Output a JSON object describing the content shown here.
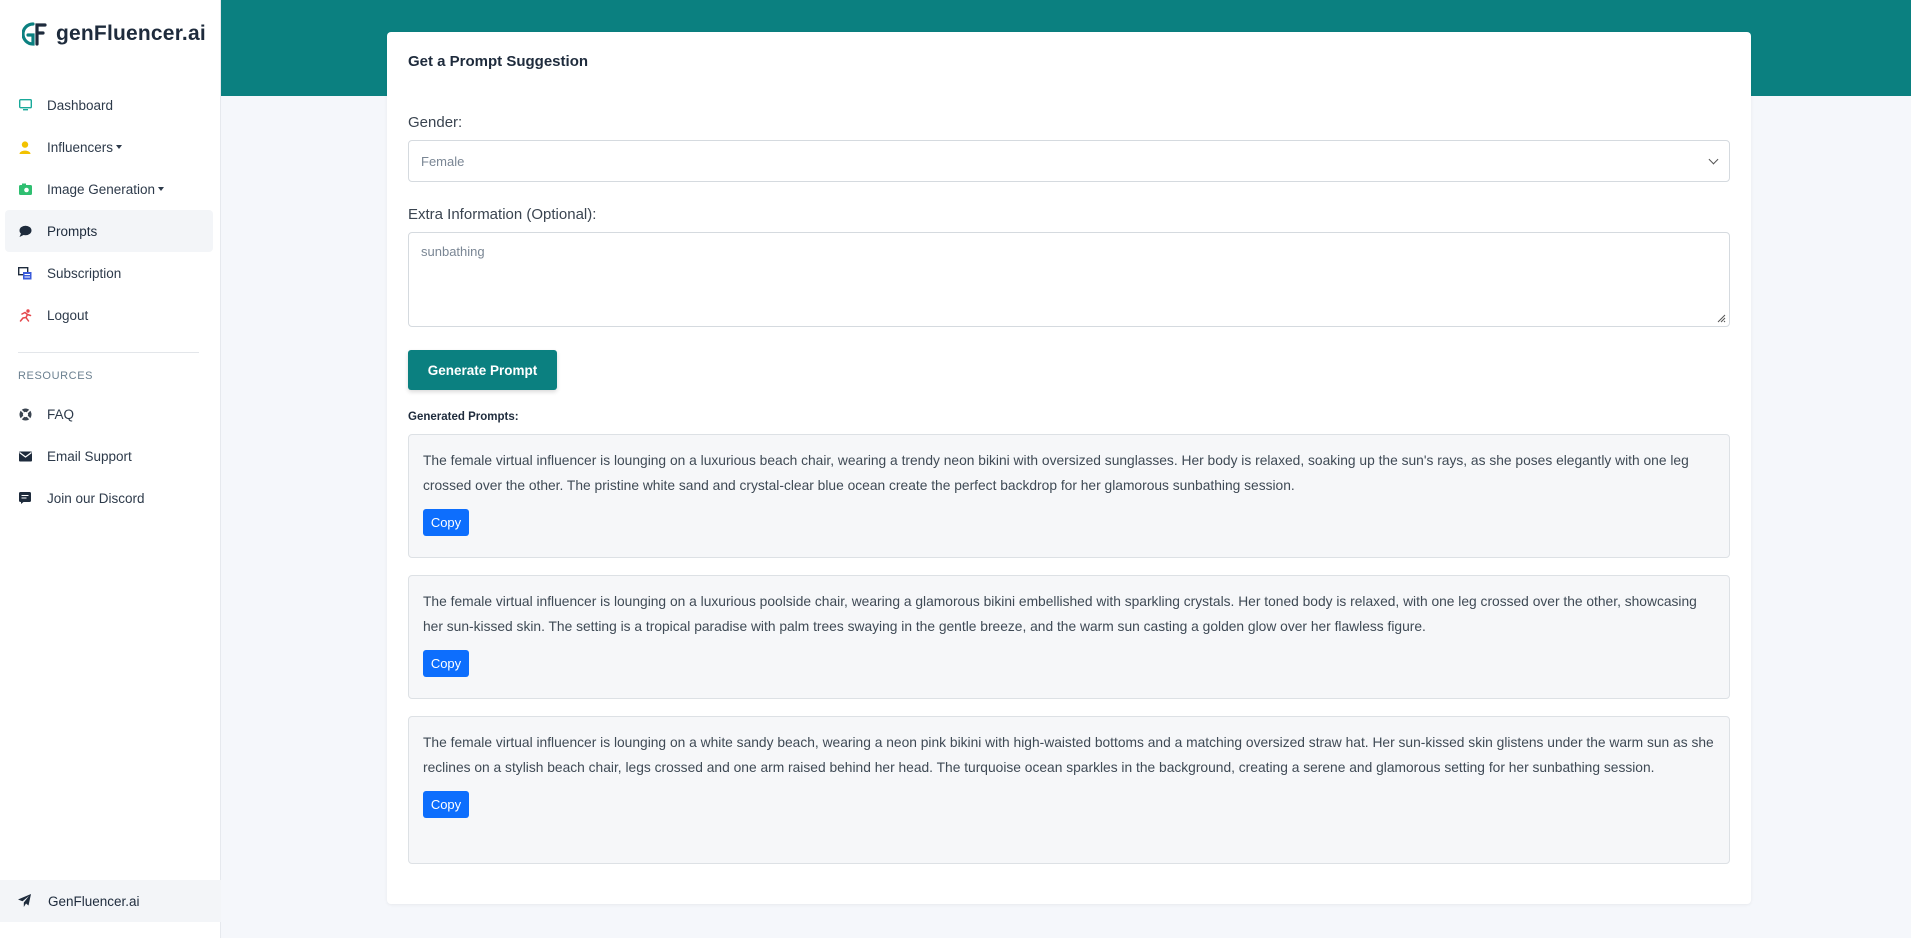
{
  "brand": {
    "name": "genFluencer.ai"
  },
  "nav": [
    {
      "label": "Dashboard",
      "icon": "monitor-icon"
    },
    {
      "label": "Influencers",
      "icon": "user-icon",
      "dropdown": true
    },
    {
      "label": "Image Generation",
      "icon": "camera-icon",
      "dropdown": true
    },
    {
      "label": "Prompts",
      "icon": "chat-bubble-icon",
      "active": true
    },
    {
      "label": "Subscription",
      "icon": "subscription-icon"
    },
    {
      "label": "Logout",
      "icon": "running-person-icon"
    }
  ],
  "resources": {
    "title": "RESOURCES",
    "items": [
      {
        "label": "FAQ",
        "icon": "lifebuoy-icon"
      },
      {
        "label": "Email Support",
        "icon": "envelope-icon"
      },
      {
        "label": "Join our Discord",
        "icon": "discord-icon"
      }
    ]
  },
  "footer": {
    "label": "GenFluencer.ai",
    "icon": "paper-plane-icon"
  },
  "card": {
    "title": "Get a Prompt Suggestion",
    "gender_label": "Gender:",
    "gender_value": "Female",
    "extra_label": "Extra Information (Optional):",
    "extra_value": "sunbathing",
    "generate_label": "Generate Prompt",
    "generated_title": "Generated Prompts:"
  },
  "prompts": [
    {
      "text": "The female virtual influencer is lounging on a luxurious beach chair, wearing a trendy neon bikini with oversized sunglasses. Her body is relaxed, soaking up the sun's rays, as she poses elegantly with one leg crossed over the other. The pristine white sand and crystal-clear blue ocean create the perfect backdrop for her glamorous sunbathing session.",
      "copy_label": "Copy"
    },
    {
      "text": "The female virtual influencer is lounging on a luxurious poolside chair, wearing a glamorous bikini embellished with sparkling crystals. Her toned body is relaxed, with one leg crossed over the other, showcasing her sun-kissed skin. The setting is a tropical paradise with palm trees swaying in the gentle breeze, and the warm sun casting a golden glow over her flawless figure.",
      "copy_label": "Copy"
    },
    {
      "text": "The female virtual influencer is lounging on a white sandy beach, wearing a neon pink bikini with high-waisted bottoms and a matching oversized straw hat. Her sun-kissed skin glistens under the warm sun as she reclines on a stylish beach chair, legs crossed and one arm raised behind her head. The turquoise ocean sparkles in the background, creating a serene and glamorous setting for her sunbathing session.",
      "copy_label": "Copy"
    }
  ],
  "colors": {
    "accent": "#0b8080",
    "copy_button": "#0d6efd"
  }
}
